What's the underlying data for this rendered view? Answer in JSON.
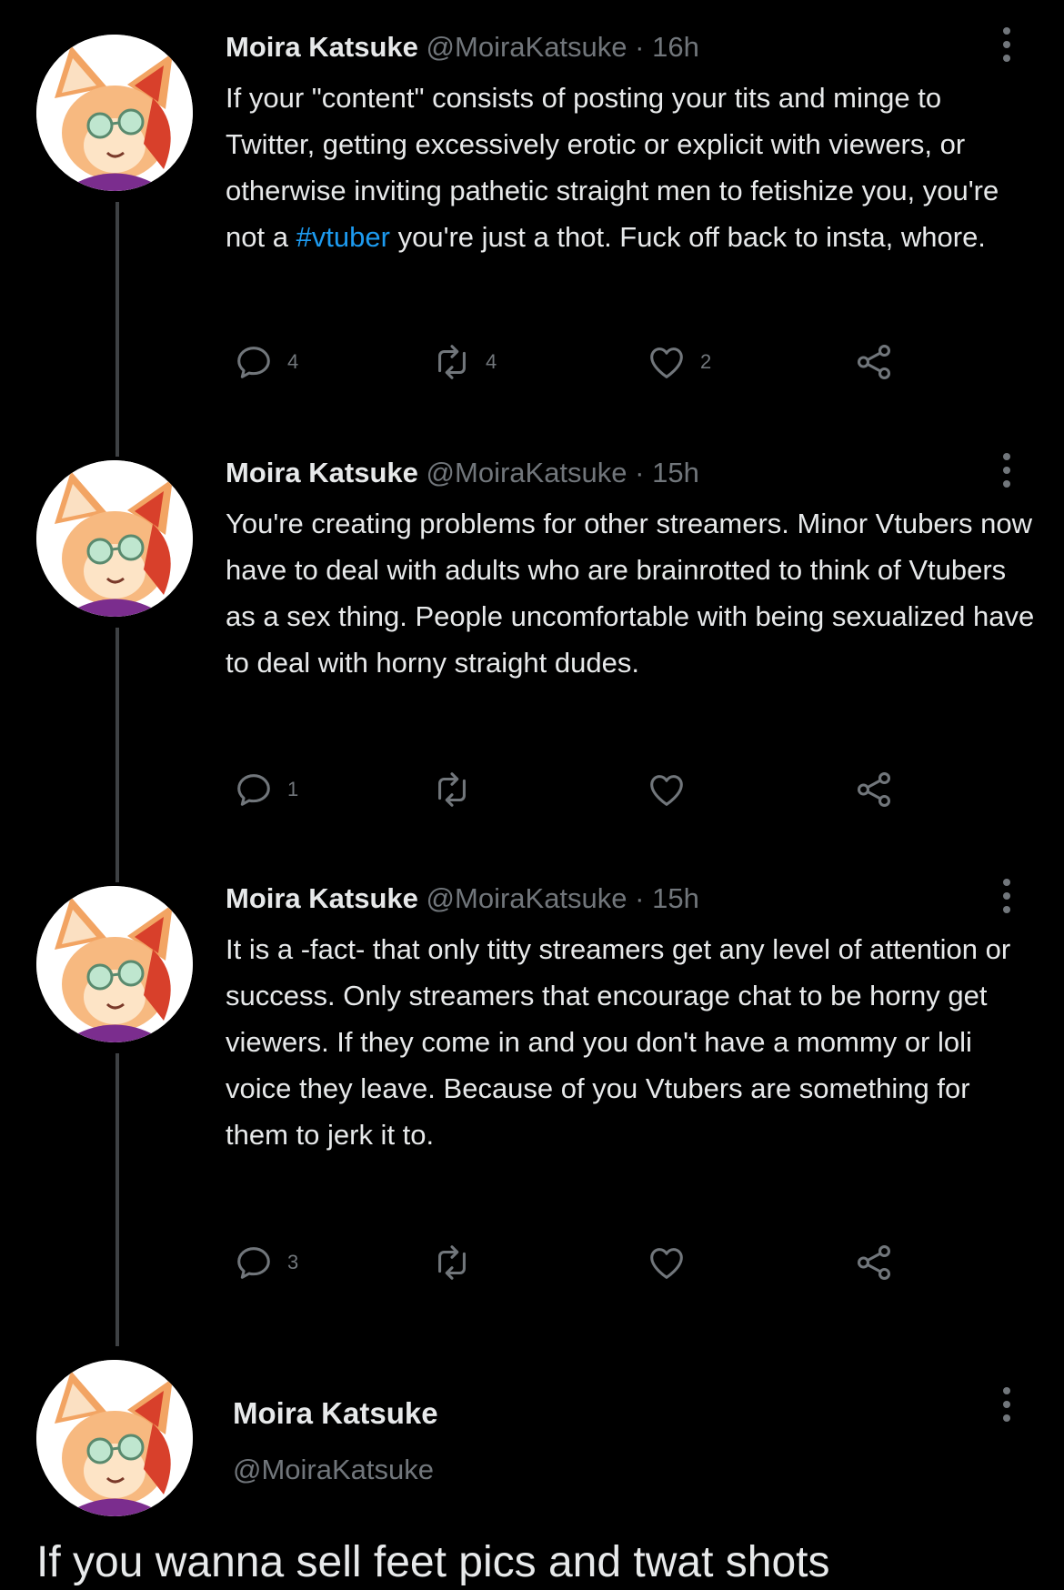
{
  "colors": {
    "background": "#000000",
    "text": "#e7e9ea",
    "muted": "#71767b",
    "link": "#1d9bf0",
    "thread_line": "#3e4144"
  },
  "icons": {
    "reply": "speech-bubble-icon",
    "retweet": "retweet-arrows-icon",
    "like": "heart-icon",
    "share": "share-nodes-icon",
    "more": "vertical-ellipsis-icon"
  },
  "tweets": [
    {
      "name": "Moira Katsuke",
      "handle": "@MoiraKatsuke",
      "sep": "·",
      "time": "16h",
      "text_before": "If your \"content\" consists of posting your tits and minge to Twitter, getting excessively erotic or explicit with viewers, or otherwise inviting pathetic straight men to fetishize you, you're not a ",
      "hashtag": "#vtuber",
      "text_after": " you're just a thot. Fuck off back to insta, whore.",
      "replies": "4",
      "retweets": "4",
      "likes": "2"
    },
    {
      "name": "Moira Katsuke",
      "handle": "@MoiraKatsuke",
      "sep": "·",
      "time": "15h",
      "text": "You're creating problems for other streamers. Minor Vtubers now have to deal with adults who are brainrotted to think of Vtubers as a sex thing. People uncomfortable with being sexualized have to deal with horny straight dudes.",
      "replies": "1",
      "retweets": "",
      "likes": ""
    },
    {
      "name": "Moira Katsuke",
      "handle": "@MoiraKatsuke",
      "sep": "·",
      "time": "15h",
      "text": "It is a -fact- that only titty streamers get any level of attention or success. Only streamers that encourage chat to be horny get viewers. If they come in and you don't have a mommy or loli voice they leave. Because of you Vtubers are something for them to jerk it to.",
      "replies": "3",
      "retweets": "",
      "likes": ""
    }
  ],
  "final_tweet": {
    "name": "Moira Katsuke",
    "handle": "@MoiraKatsuke",
    "text": "If you wanna sell feet pics and twat shots"
  }
}
